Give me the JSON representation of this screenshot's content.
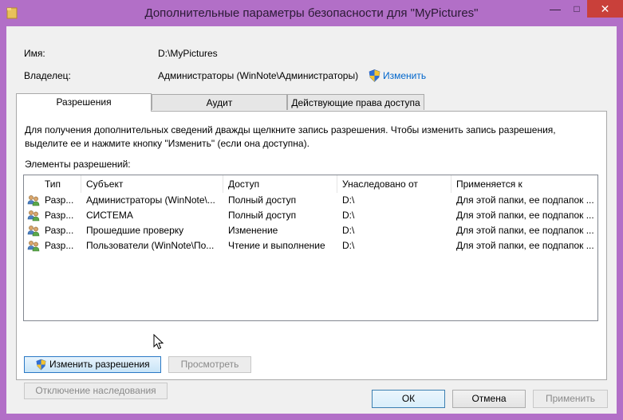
{
  "window": {
    "title": "Дополнительные параметры безопасности  для \"MyPictures\"",
    "minimize": "—",
    "maximize": "□",
    "close": "✕"
  },
  "info": {
    "name_label": "Имя:",
    "name_value": "D:\\MyPictures",
    "owner_label": "Владелец:",
    "owner_value": "Администраторы (WinNote\\Администраторы)",
    "change_link": "Изменить"
  },
  "tabs": [
    {
      "label": "Разрешения",
      "active": true
    },
    {
      "label": "Аудит",
      "active": false
    },
    {
      "label": "Действующие права доступа",
      "active": false
    }
  ],
  "permissions": {
    "description": "Для получения дополнительных сведений дважды щелкните запись разрешения. Чтобы изменить запись разрешения, выделите ее и нажмите кнопку \"Изменить\" (если она доступна).",
    "list_title": "Элементы разрешений:",
    "columns": [
      "Тип",
      "Субъект",
      "Доступ",
      "Унаследовано от",
      "Применяется к"
    ],
    "rows": [
      {
        "type": "Разр...",
        "subject": "Администраторы (WinNote\\...",
        "access": "Полный доступ",
        "inherited": "D:\\",
        "applies": "Для этой папки, ее подпапок ..."
      },
      {
        "type": "Разр...",
        "subject": "СИСТЕМА",
        "access": "Полный доступ",
        "inherited": "D:\\",
        "applies": "Для этой папки, ее подпапок ..."
      },
      {
        "type": "Разр...",
        "subject": "Прошедшие проверку",
        "access": "Изменение",
        "inherited": "D:\\",
        "applies": "Для этой папки, ее подпапок ..."
      },
      {
        "type": "Разр...",
        "subject": "Пользователи (WinNote\\По...",
        "access": "Чтение и выполнение",
        "inherited": "D:\\",
        "applies": "Для этой папки, ее подпапок ..."
      }
    ]
  },
  "buttons": {
    "change_permissions": "Изменить разрешения",
    "view": "Просмотреть",
    "disable_inheritance": "Отключение наследования",
    "ok": "ОК",
    "cancel": "Отмена",
    "apply": "Применить"
  },
  "colors": {
    "titlebar": "#b26fc7",
    "close": "#c9403a",
    "link": "#0066cc"
  }
}
